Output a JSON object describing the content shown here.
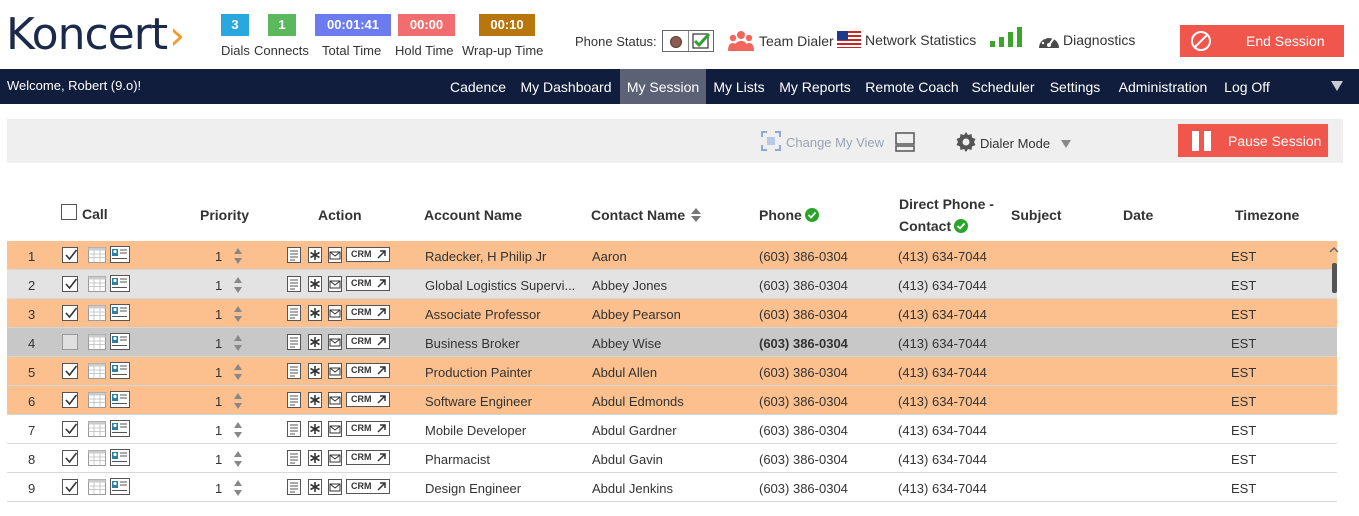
{
  "app": {
    "logo_text": "Koncert",
    "brand_color": "#1b2a4a",
    "accent_color": "#f39a2a"
  },
  "counters": [
    {
      "key": "dials",
      "value": "3",
      "label": "Dials",
      "color": "#29a8df"
    },
    {
      "key": "connects",
      "value": "1",
      "label": "Connects",
      "color": "#5cb85c"
    },
    {
      "key": "total_time",
      "value": "00:01:41",
      "label": "Total Time",
      "color": "#6c7cf0"
    },
    {
      "key": "hold_time",
      "value": "00:00",
      "label": "Hold Time",
      "color": "#f26d6d"
    },
    {
      "key": "wrapup_time",
      "value": "00:10",
      "label": "Wrap-up Time",
      "color": "#b8760f"
    }
  ],
  "phone_status": {
    "label": "Phone Status:",
    "icons": [
      "status-dot-icon",
      "check-icon"
    ]
  },
  "header_links": {
    "team_dialer": "Team Dialer",
    "network_statistics": "Network Statistics",
    "diagnostics": "Diagnostics"
  },
  "end_session": {
    "label": "End Session",
    "icon": "ban-icon",
    "color": "#f1564d"
  },
  "navbar": {
    "welcome": "Welcome, Robert (9.o)!",
    "items": [
      {
        "label": "Cadence",
        "active": false
      },
      {
        "label": "My Dashboard",
        "active": false
      },
      {
        "label": "My Session",
        "active": true
      },
      {
        "label": "My Lists",
        "active": false
      },
      {
        "label": "My Reports",
        "active": false
      },
      {
        "label": "Remote Coach",
        "active": false
      },
      {
        "label": "Scheduler",
        "active": false
      },
      {
        "label": "Settings",
        "active": false
      },
      {
        "label": "Administration",
        "active": false
      },
      {
        "label": "Log Off",
        "active": false
      }
    ]
  },
  "toolbar": {
    "change_view": "Change My View",
    "dialer_mode": "Dialer Mode",
    "pause_session": "Pause Session"
  },
  "table": {
    "headers": {
      "call": "Call",
      "priority": "Priority",
      "action": "Action",
      "account_name": "Account Name",
      "contact_name": "Contact Name",
      "phone": "Phone",
      "direct_phone_line1": "Direct Phone -",
      "direct_phone_line2": "Contact",
      "subject": "Subject",
      "date": "Date",
      "timezone": "Timezone"
    },
    "crm_label": "CRM",
    "rows": [
      {
        "num": "1",
        "checked": true,
        "priority": "1",
        "account": "Radecker, H Philip Jr",
        "contact": "Aaron",
        "phone": "(603) 386-0304",
        "direct": "(413) 634-7044",
        "subject": "",
        "date": "",
        "timezone": "EST",
        "style": "orange",
        "bold_phone": false
      },
      {
        "num": "2",
        "checked": true,
        "priority": "1",
        "account": "Global Logistics Supervi...",
        "contact": "Abbey Jones",
        "phone": "(603) 386-0304",
        "direct": "(413) 634-7044",
        "subject": "",
        "date": "",
        "timezone": "EST",
        "style": "grey",
        "bold_phone": false
      },
      {
        "num": "3",
        "checked": true,
        "priority": "1",
        "account": "Associate Professor",
        "contact": "Abbey Pearson",
        "phone": "(603) 386-0304",
        "direct": "(413) 634-7044",
        "subject": "",
        "date": "",
        "timezone": "EST",
        "style": "orange",
        "bold_phone": false
      },
      {
        "num": "4",
        "checked": false,
        "priority": "1",
        "account": "Business Broker",
        "contact": "Abbey Wise",
        "phone": "(603) 386-0304",
        "direct": "(413) 634-7044",
        "subject": "",
        "date": "",
        "timezone": "EST",
        "style": "dark",
        "bold_phone": true
      },
      {
        "num": "5",
        "checked": true,
        "priority": "1",
        "account": "Production Painter",
        "contact": "Abdul Allen",
        "phone": "(603) 386-0304",
        "direct": "(413) 634-7044",
        "subject": "",
        "date": "",
        "timezone": "EST",
        "style": "orange",
        "bold_phone": false
      },
      {
        "num": "6",
        "checked": true,
        "priority": "1",
        "account": "Software Engineer",
        "contact": "Abdul Edmonds",
        "phone": "(603) 386-0304",
        "direct": "(413) 634-7044",
        "subject": "",
        "date": "",
        "timezone": "EST",
        "style": "orange",
        "bold_phone": false
      },
      {
        "num": "7",
        "checked": true,
        "priority": "1",
        "account": "Mobile Developer",
        "contact": "Abdul Gardner",
        "phone": "(603) 386-0304",
        "direct": "(413) 634-7044",
        "subject": "",
        "date": "",
        "timezone": "EST",
        "style": "white",
        "bold_phone": false
      },
      {
        "num": "8",
        "checked": true,
        "priority": "1",
        "account": "Pharmacist",
        "contact": "Abdul Gavin",
        "phone": "(603) 386-0304",
        "direct": "(413) 634-7044",
        "subject": "",
        "date": "",
        "timezone": "EST",
        "style": "white",
        "bold_phone": false
      },
      {
        "num": "9",
        "checked": true,
        "priority": "1",
        "account": "Design Engineer",
        "contact": "Abdul Jenkins",
        "phone": "(603) 386-0304",
        "direct": "(413) 634-7044",
        "subject": "",
        "date": "",
        "timezone": "EST",
        "style": "white",
        "bold_phone": false
      }
    ]
  }
}
